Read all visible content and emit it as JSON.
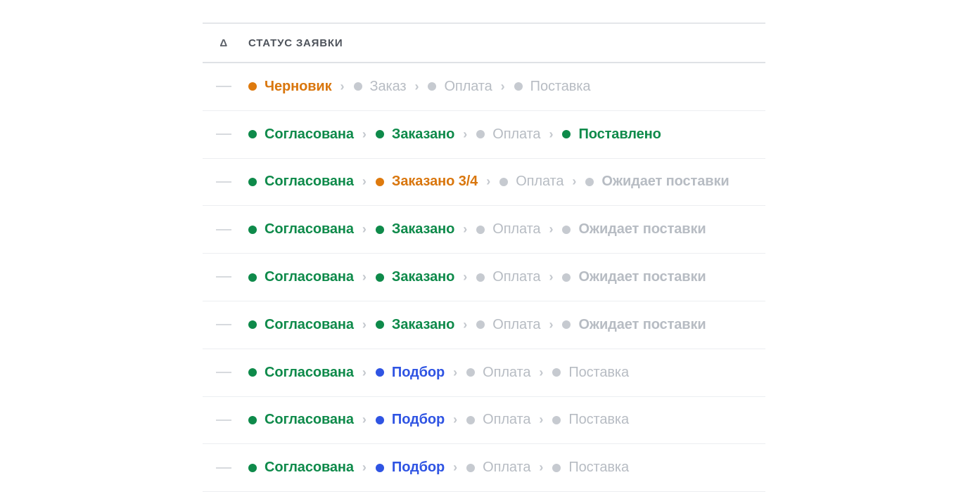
{
  "table": {
    "header": {
      "delta_label": "Δ",
      "status_label": "СТАТУС ЗАЯВКИ"
    },
    "separator_glyph": "›",
    "rows": [
      {
        "delta": "—",
        "steps": [
          {
            "label": "Черновик",
            "state": "orange"
          },
          {
            "label": "Заказ",
            "state": "gray"
          },
          {
            "label": "Оплата",
            "state": "gray"
          },
          {
            "label": "Поставка",
            "state": "gray"
          }
        ]
      },
      {
        "delta": "—",
        "steps": [
          {
            "label": "Согласована",
            "state": "green"
          },
          {
            "label": "Заказано",
            "state": "green"
          },
          {
            "label": "Оплата",
            "state": "gray"
          },
          {
            "label": "Поставлено",
            "state": "green"
          }
        ]
      },
      {
        "delta": "—",
        "steps": [
          {
            "label": "Согласована",
            "state": "green"
          },
          {
            "label": "Заказано 3/4",
            "state": "orange"
          },
          {
            "label": "Оплата",
            "state": "gray"
          },
          {
            "label": "Ожидает поставки",
            "state": "gray-bold"
          }
        ]
      },
      {
        "delta": "—",
        "steps": [
          {
            "label": "Согласована",
            "state": "green"
          },
          {
            "label": "Заказано",
            "state": "green"
          },
          {
            "label": "Оплата",
            "state": "gray"
          },
          {
            "label": "Ожидает поставки",
            "state": "gray-bold"
          }
        ]
      },
      {
        "delta": "—",
        "steps": [
          {
            "label": "Согласована",
            "state": "green"
          },
          {
            "label": "Заказано",
            "state": "green"
          },
          {
            "label": "Оплата",
            "state": "gray"
          },
          {
            "label": "Ожидает поставки",
            "state": "gray-bold"
          }
        ]
      },
      {
        "delta": "—",
        "steps": [
          {
            "label": "Согласована",
            "state": "green"
          },
          {
            "label": "Заказано",
            "state": "green"
          },
          {
            "label": "Оплата",
            "state": "gray"
          },
          {
            "label": "Ожидает поставки",
            "state": "gray-bold"
          }
        ]
      },
      {
        "delta": "—",
        "steps": [
          {
            "label": "Согласована",
            "state": "green"
          },
          {
            "label": "Подбор",
            "state": "blue"
          },
          {
            "label": "Оплата",
            "state": "gray"
          },
          {
            "label": "Поставка",
            "state": "gray"
          }
        ]
      },
      {
        "delta": "—",
        "steps": [
          {
            "label": "Согласована",
            "state": "green"
          },
          {
            "label": "Подбор",
            "state": "blue"
          },
          {
            "label": "Оплата",
            "state": "gray"
          },
          {
            "label": "Поставка",
            "state": "gray"
          }
        ]
      },
      {
        "delta": "—",
        "steps": [
          {
            "label": "Согласована",
            "state": "green"
          },
          {
            "label": "Подбор",
            "state": "blue"
          },
          {
            "label": "Оплата",
            "state": "gray"
          },
          {
            "label": "Поставка",
            "state": "gray"
          }
        ]
      }
    ]
  },
  "colors": {
    "green": "#0e8a4a",
    "orange": "#d9760d",
    "blue": "#2f54e3",
    "gray": "#b7bcc3"
  },
  "icons": {
    "delta_empty": "dash-icon",
    "separator": "chevron-right-icon",
    "status_marker": "dot-icon"
  }
}
